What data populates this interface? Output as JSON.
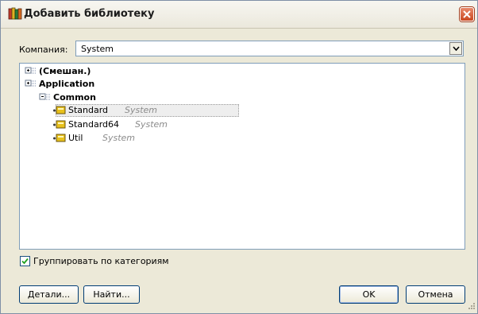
{
  "window": {
    "title": "Добавить библиотеку",
    "icon": "library-books-icon"
  },
  "company": {
    "label": "Компания:",
    "value": "System"
  },
  "tree": [
    {
      "label": "(Смешан.)",
      "bold": true,
      "company": ""
    },
    {
      "label": "Application",
      "bold": true,
      "company": ""
    },
    {
      "label": "Common",
      "bold": true,
      "company": ""
    },
    {
      "label": "Standard",
      "bold": false,
      "company": "System",
      "selected": true
    },
    {
      "label": "Standard64",
      "bold": false,
      "company": "System"
    },
    {
      "label": "Util",
      "bold": false,
      "company": "System"
    }
  ],
  "group_by_category": {
    "label": "Группировать по категориям",
    "checked": true
  },
  "buttons": {
    "details": "Детали...",
    "find": "Найти...",
    "ok": "OK",
    "cancel": "Отмена"
  }
}
